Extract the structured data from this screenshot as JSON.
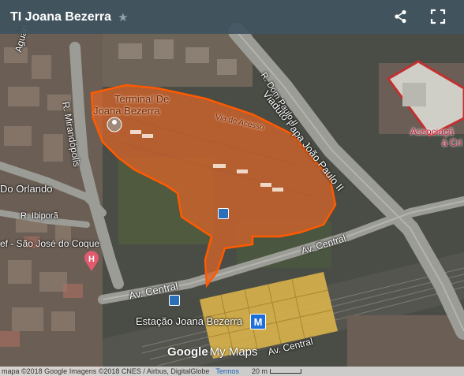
{
  "header": {
    "title": "TI Joana Bezerra",
    "star_icon": "star-icon",
    "share_icon": "share-icon",
    "fullscreen_icon": "fullscreen-icon"
  },
  "map": {
    "highlight_color": "#d9642a",
    "labels": {
      "terminal_line1": "Terminal De",
      "terminal_line2": "Joana Bezerra",
      "via_acesso": "Via de Acesso",
      "viaduto": "Viaduto Papa João Paulo II",
      "dom_paulo": "R. Dom Paulo II",
      "mirandopolis": "R. Mirandópolis",
      "aguari": "Aguari",
      "do_orlando": "Do Orlando",
      "ibipora": "R. Ibiporã",
      "sao_jose": "ef - São José do Coque",
      "av_central_1": "Av. Central",
      "av_central_2": "Av. Central",
      "av_central_3": "Av. Central",
      "estacao": "Estação Joana Bezerra",
      "associacao_1": "Associaçã",
      "associacao_2": "à Cri",
      "google": "Google",
      "mymaps": "My Maps"
    }
  },
  "footer": {
    "attribution": "mapa ©2018 Google Imagens ©2018 CNES / Airbus, DigitalGlobe",
    "terms": "Termos",
    "scale": "20 m"
  }
}
